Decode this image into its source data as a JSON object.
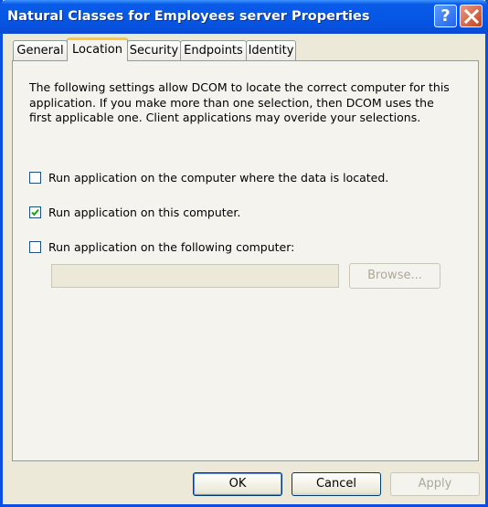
{
  "window": {
    "title": "Natural Classes for Employees server Properties",
    "help_button": "?",
    "close_button": "X"
  },
  "tabs": [
    {
      "label": "General",
      "active": false
    },
    {
      "label": "Location",
      "active": true
    },
    {
      "label": "Security",
      "active": false
    },
    {
      "label": "Endpoints",
      "active": false
    },
    {
      "label": "Identity",
      "active": false
    }
  ],
  "location": {
    "description": "The following settings allow DCOM to locate the correct computer for this application. If you make more than one selection, then DCOM uses the first applicable one. Client applications may overide your selections.",
    "options": [
      {
        "label": "Run application on the computer where the data is located.",
        "checked": false
      },
      {
        "label": "Run application on this computer.",
        "checked": true
      },
      {
        "label": "Run application on the following computer:",
        "checked": false
      }
    ],
    "computer_value": "",
    "browse_label": "Browse..."
  },
  "footer": {
    "ok_label": "OK",
    "cancel_label": "Cancel",
    "apply_label": "Apply"
  },
  "colors": {
    "titlebar": "#0658e4",
    "dialog_bg": "#ece9d8",
    "active_tab_accent": "#ffc83c"
  }
}
